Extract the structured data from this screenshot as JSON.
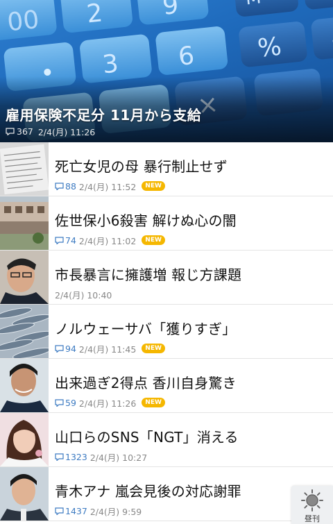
{
  "hero": {
    "headline": "雇用保険不足分 11月から支給",
    "comment_count": "367",
    "timestamp": "2/4(月) 11:26"
  },
  "items": [
    {
      "title": "死亡女児の母 暴行制止せず",
      "comment_count": "88",
      "timestamp": "2/4(月) 11:52",
      "badge": "NEW"
    },
    {
      "title": "佐世保小6殺害 解けぬ心の闇",
      "comment_count": "74",
      "timestamp": "2/4(月) 11:02",
      "badge": "NEW"
    },
    {
      "title": "市長暴言に擁護増 報じ方課題",
      "comment_count": "",
      "timestamp": "2/4(月) 10:40",
      "badge": ""
    },
    {
      "title": "ノルウェーサバ「獲りすぎ」",
      "comment_count": "94",
      "timestamp": "2/4(月) 11:45",
      "badge": "NEW"
    },
    {
      "title": "出来過ぎ2得点 香川自身驚き",
      "comment_count": "59",
      "timestamp": "2/4(月) 11:26",
      "badge": "NEW"
    },
    {
      "title": "山口らのSNS「NGT」消える",
      "comment_count": "1323",
      "timestamp": "2/4(月) 10:27",
      "badge": ""
    },
    {
      "title": "青木アナ 嵐会見後の対応謝罪",
      "comment_count": "1437",
      "timestamp": "2/4(月) 9:59",
      "badge": ""
    }
  ],
  "fab": {
    "label": "昼刊",
    "icon": "sun-icon"
  },
  "colors": {
    "accent": "#3d7bc2",
    "new_badge": "#f5b700"
  }
}
